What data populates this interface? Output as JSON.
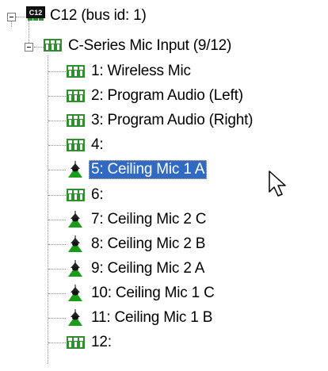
{
  "tree": {
    "root": {
      "label": "C12 (bus id: 1)",
      "badge_text": "C12",
      "expanded": true
    },
    "group": {
      "label": "C-Series Mic Input (9/12)",
      "expanded": true
    },
    "items": [
      {
        "label": "1: Wireless Mic",
        "icon": "input-block-icon"
      },
      {
        "label": "2: Program Audio (Left)",
        "icon": "input-block-icon"
      },
      {
        "label": "3: Program Audio (Right)",
        "icon": "input-block-icon"
      },
      {
        "label": "4:",
        "icon": "input-block-icon"
      },
      {
        "label": "5: Ceiling Mic 1 A",
        "icon": "ceiling-mic-icon",
        "selected": true
      },
      {
        "label": "6:",
        "icon": "input-block-icon"
      },
      {
        "label": "7: Ceiling Mic 2 C",
        "icon": "ceiling-mic-icon"
      },
      {
        "label": "8: Ceiling Mic 2 B",
        "icon": "ceiling-mic-icon"
      },
      {
        "label": "9: Ceiling Mic 2 A",
        "icon": "ceiling-mic-icon"
      },
      {
        "label": "10: Ceiling Mic 1 C",
        "icon": "ceiling-mic-icon"
      },
      {
        "label": "11: Ceiling Mic 1 B",
        "icon": "ceiling-mic-icon"
      },
      {
        "label": "12:",
        "icon": "input-block-icon"
      }
    ]
  },
  "colors": {
    "selection_bg": "#316ac5",
    "selection_text": "#ffffff",
    "icon_green": "#2f8f2f",
    "mic_green": "#1a9c1a",
    "mic_dark": "#222222"
  }
}
